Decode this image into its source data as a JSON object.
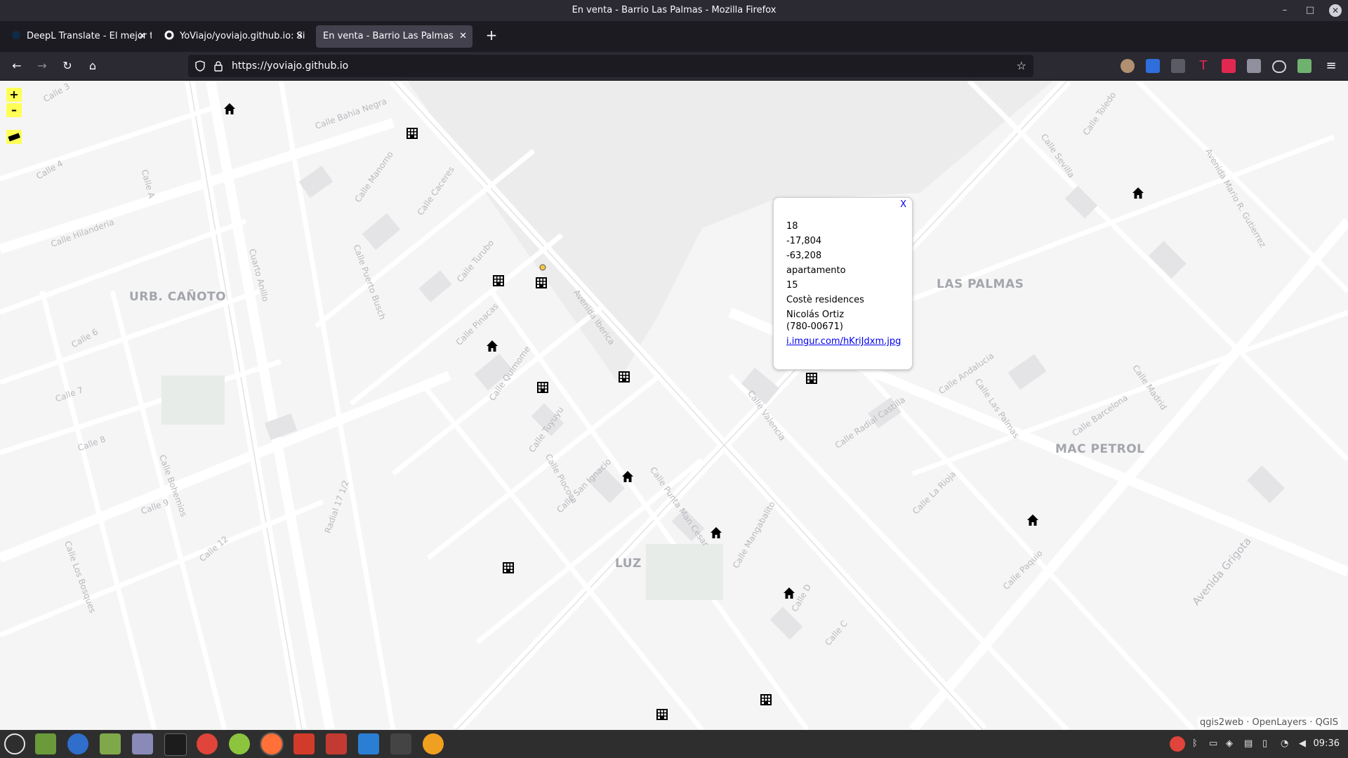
{
  "window": {
    "title": "En venta - Barrio Las Palmas - Mozilla Firefox",
    "controls": {
      "minimize": "–",
      "maximize": "□",
      "close": "✕"
    }
  },
  "tabs": [
    {
      "title": "DeepL Translate - El mejor tr",
      "close": "✕"
    },
    {
      "title": "YoViajo/yoviajo.github.io: Si",
      "close": "✕"
    },
    {
      "title": "En venta - Barrio Las Palmas",
      "close": "✕"
    }
  ],
  "new_tab": "+",
  "nav": {
    "back": "←",
    "forward": "→",
    "reload": "↻",
    "home": "⌂",
    "url": "https://yoviajo.github.io",
    "bookmark_star": "☆",
    "menu": "≡"
  },
  "map": {
    "zoom_in": "+",
    "zoom_out": "–",
    "areas": [
      "URB. CAÑOTO",
      "LAS PALMAS",
      "MAC PETROL",
      "LUZ"
    ],
    "streets": [
      "Calle 3",
      "Calle 4",
      "Calle A",
      "Calle Bahia Negra",
      "Calle Hilanderia",
      "Calle Manomo",
      "Calle Caceres",
      "Calle 6",
      "Cuarto Anillo",
      "Calle Puerto Busch",
      "Calle Turubo",
      "Calle Pinacas",
      "Calle 7",
      "Calle Quimome",
      "Avenida Iberica",
      "Calle 8",
      "Calle Tuyuyu",
      "Calle 9",
      "Calle San Ignacio",
      "Calle Punta Man Cesar",
      "Calle Valencia",
      "Calle Radial Castilla",
      "Calle Andalucia",
      "Calle Las Palmas",
      "Calle Barcelona",
      "Calle Madrid",
      "Calle Sevilla",
      "Calle Toledo",
      "Avenida Mario R. Gutierrez",
      "Calle Los Bosques",
      "Calle Bohemios",
      "Calle 12",
      "Radial 17 1/2",
      "Calle Piococa",
      "Calle Mangabalito",
      "Calle La Rioja",
      "Calle Paquio",
      "Avenida Grigota",
      "Calle D",
      "Calle C"
    ],
    "attribution": "qgis2web · OpenLayers · QGIS"
  },
  "popup": {
    "close": "X",
    "lines": [
      "18",
      "-17,804",
      "-63,208",
      "apartamento",
      "15",
      "Costè residences",
      "Nicolás Ortiz",
      "(780-00671)"
    ],
    "link": "i.imgur.com/hKriJdxm.jpg"
  },
  "taskbar": {
    "clock": "09:36"
  },
  "colors": {
    "titlebar": "#2b2a33",
    "tabbar": "#1c1b22",
    "active_tab": "#42414d",
    "zoom_bg": "#ffff55",
    "map_bg": "#f5f5f5",
    "link": "#0000ee"
  }
}
